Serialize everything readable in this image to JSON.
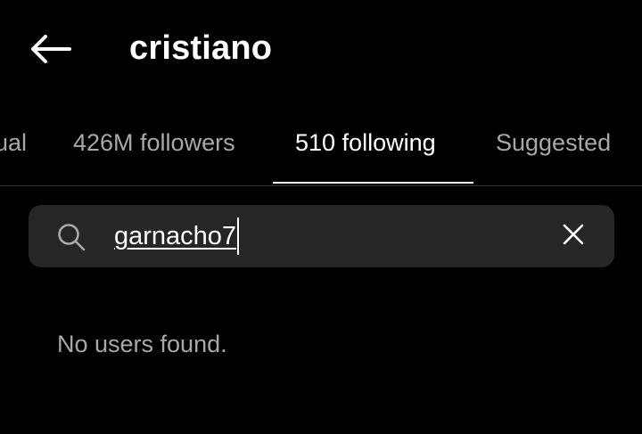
{
  "header": {
    "title": "cristiano",
    "back_icon": "arrow-left-icon"
  },
  "tabs": [
    {
      "label": "ual",
      "active": false
    },
    {
      "label": "426M followers",
      "active": false
    },
    {
      "label": "510 following",
      "active": true
    },
    {
      "label": "Suggested",
      "active": false
    }
  ],
  "search": {
    "value": "garnacho7",
    "icon": "search-icon",
    "clear_icon": "close-icon"
  },
  "results": {
    "empty_message": "No users found."
  },
  "colors": {
    "background": "#000000",
    "search_bg": "#262626",
    "text_primary": "#ffffff",
    "text_secondary": "#a8a8a8",
    "divider": "#363636"
  }
}
